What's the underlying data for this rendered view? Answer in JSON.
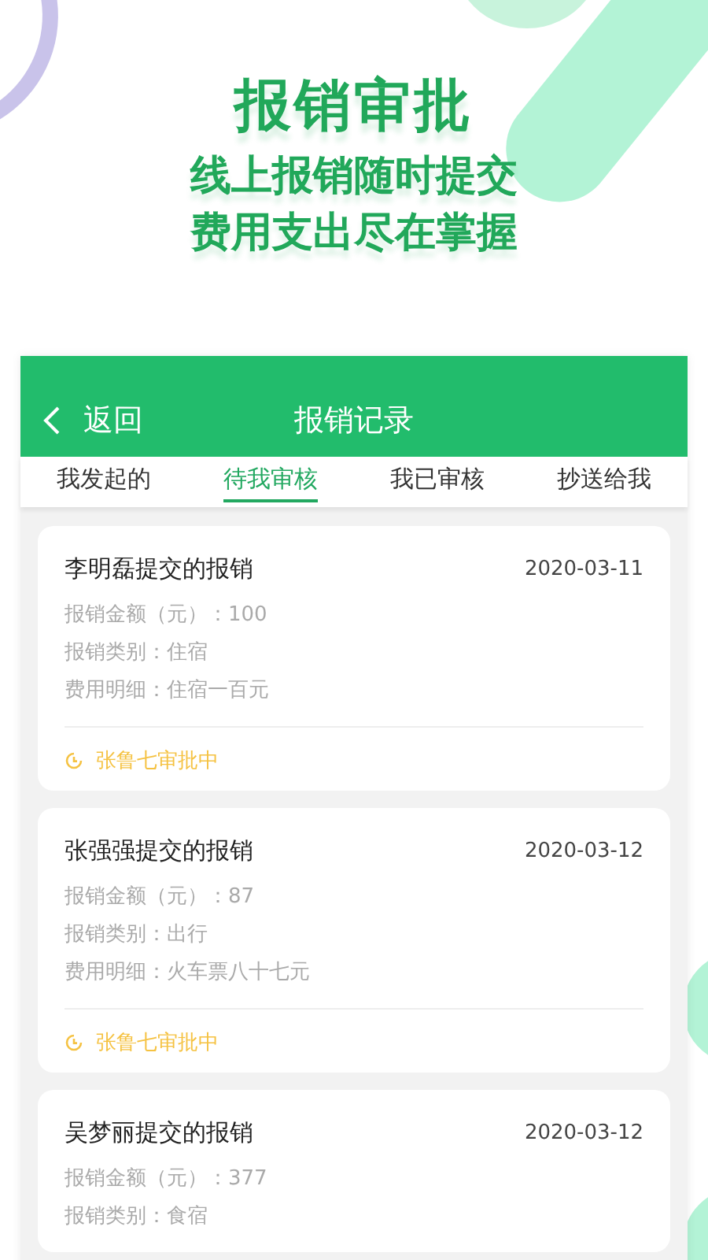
{
  "promo": {
    "title": "报销审批",
    "lines": [
      "线上报销随时提交",
      "费用支出尽在掌握"
    ]
  },
  "header": {
    "back_label": "返回",
    "title": "报销记录"
  },
  "tabs": [
    {
      "label": "我发起的",
      "selected": false
    },
    {
      "label": "待我审核",
      "selected": true
    },
    {
      "label": "我已审核",
      "selected": false
    },
    {
      "label": "抄送给我",
      "selected": false
    }
  ],
  "records": [
    {
      "title": "李明磊提交的报销",
      "date": "2020-03-11",
      "fields": [
        "报销金额（元）：100",
        "报销类别：住宿",
        "费用明细：住宿一百元"
      ],
      "status": "张鲁七审批中"
    },
    {
      "title": "张强强提交的报销",
      "date": "2020-03-12",
      "fields": [
        "报销金额（元）：87",
        "报销类别：出行",
        "费用明细：火车票八十七元"
      ],
      "status": "张鲁七审批中"
    },
    {
      "title": "吴梦丽提交的报销",
      "date": "2020-03-12",
      "fields": [
        "报销金额（元）：377",
        "报销类别：食宿"
      ]
    }
  ]
}
